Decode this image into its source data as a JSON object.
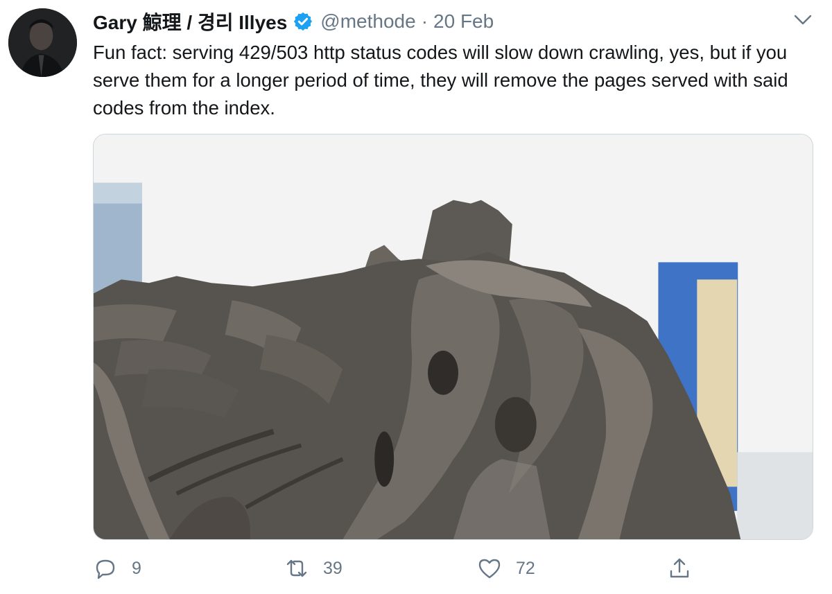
{
  "tweet": {
    "author": {
      "display_name": "Gary 鯨理 / 경리 Illyes",
      "handle": "@methode",
      "verified": true
    },
    "separator": "·",
    "date": "20 Feb",
    "text": "Fun fact: serving 429/503 http status codes will slow down crawling, yes, but if you serve them for a longer period of time, they will remove the pages served with said codes from the index."
  },
  "actions": {
    "reply_count": "9",
    "retweet_count": "39",
    "like_count": "72"
  },
  "icons": {
    "verified": "verified-badge-icon",
    "more": "chevron-down-icon",
    "reply": "reply-icon",
    "retweet": "retweet-icon",
    "like": "heart-icon",
    "share": "share-icon"
  },
  "colors": {
    "verified_blue": "#1da1f2",
    "muted_text": "#657786",
    "primary_text": "#14171a"
  }
}
